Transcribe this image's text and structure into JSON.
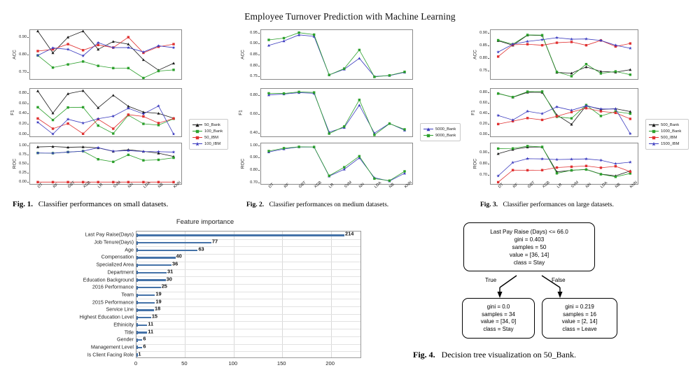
{
  "document": {
    "title": "Employee Turnover Prediction with Machine Learning"
  },
  "figures": {
    "fig1": {
      "caption_label": "Fig. 1.",
      "caption_text": "Classifier performances on small datasets.",
      "legend": [
        "50_Bank",
        "100_Bank",
        "50_IBM",
        "100_IBM"
      ]
    },
    "fig2": {
      "caption_label": "Fig. 2.",
      "caption_text": "Classifier performances on medium datasets.",
      "legend": [
        "5000_Bank",
        "9000_Bank"
      ]
    },
    "fig3": {
      "caption_label": "Fig. 3.",
      "caption_text": "Classifier performances on large datasets.",
      "legend": [
        "500_Bank",
        "1000_Bank",
        "500_IBM",
        "1500_IBM"
      ]
    },
    "fig4": {
      "caption_label": "Fig. 4.",
      "caption_text": "Decision tree visualization on 50_Bank."
    }
  },
  "chart_data": [
    {
      "id": "fig1",
      "type": "line",
      "title": "Classifier performances on small datasets",
      "xlabel": "",
      "categories": [
        "DT",
        "RF",
        "GBT",
        "XGB",
        "LR",
        "SVM",
        "NN",
        "LDA",
        "NB",
        "KNN"
      ],
      "legend_position": "right",
      "grid": false,
      "panels": [
        {
          "ylabel": "ACC",
          "ylim": [
            0.655,
            0.945
          ],
          "yticks": [
            0.7,
            0.8,
            0.9
          ],
          "ytick_labels": [
            "0.70",
            "0.80",
            "0.90"
          ],
          "series": [
            {
              "name": "50_Bank",
              "color": "#1a1a1a",
              "marker": "triangle",
              "values": [
                0.935,
                0.81,
                0.9,
                0.935,
                0.83,
                0.875,
                0.86,
                0.77,
                0.71,
                0.75
              ]
            },
            {
              "name": "100_Bank",
              "color": "#2ca02c",
              "marker": "square",
              "values": [
                0.795,
                0.725,
                0.743,
                0.76,
                0.735,
                0.722,
                0.722,
                0.665,
                0.705,
                0.712
              ]
            },
            {
              "name": "50_IBM",
              "color": "#e03131",
              "marker": "square",
              "values": [
                0.82,
                0.83,
                0.86,
                0.825,
                0.855,
                0.84,
                0.9,
                0.81,
                0.845,
                0.86
              ]
            },
            {
              "name": "100_IBM",
              "color": "#3b3bbf",
              "marker": "star",
              "values": [
                0.795,
                0.838,
                0.83,
                0.793,
                0.868,
                0.84,
                0.84,
                0.815,
                0.85,
                0.84
              ]
            }
          ]
        },
        {
          "ylabel": "F1",
          "ylim": [
            -0.06,
            0.9
          ],
          "yticks": [
            0.0,
            0.2,
            0.4,
            0.6,
            0.8
          ],
          "ytick_labels": [
            "0.00",
            "0.20",
            "0.40",
            "0.60",
            "0.80"
          ],
          "series": [
            {
              "name": "50_Bank",
              "color": "#1a1a1a",
              "marker": "triangle",
              "values": [
                0.845,
                0.41,
                0.79,
                0.85,
                0.515,
                0.76,
                0.545,
                0.43,
                0.405,
                0.31
              ]
            },
            {
              "name": "100_Bank",
              "color": "#2ca02c",
              "marker": "square",
              "values": [
                0.525,
                0.275,
                0.52,
                0.525,
                0.165,
                0.01,
                0.37,
                0.2,
                0.175,
                0.3
              ]
            },
            {
              "name": "50_IBM",
              "color": "#e03131",
              "marker": "square",
              "values": [
                0.305,
                0.105,
                0.205,
                0.005,
                0.29,
                0.105,
                0.38,
                0.345,
                0.215,
                0.305
              ]
            },
            {
              "name": "100_IBM",
              "color": "#3b3bbf",
              "marker": "star",
              "values": [
                0.23,
                0.0,
                0.29,
                0.215,
                0.3,
                0.35,
                0.505,
                0.395,
                0.55,
                0.0
              ]
            }
          ]
        },
        {
          "ylabel": "ROC",
          "ylim": [
            -0.07,
            1.07
          ],
          "yticks": [
            0.0,
            0.25,
            0.5,
            0.75,
            1.0
          ],
          "ytick_labels": [
            "0.00",
            "0.25",
            "0.50",
            "0.75",
            "1.00"
          ],
          "series": [
            {
              "name": "50_Bank",
              "color": "#1a1a1a",
              "marker": "triangle",
              "values": [
                0.955,
                0.965,
                0.945,
                0.955,
                0.93,
                0.835,
                0.88,
                0.835,
                0.785,
                0.695
              ]
            },
            {
              "name": "100_Bank",
              "color": "#2ca02c",
              "marker": "square",
              "values": [
                0.79,
                0.785,
                0.815,
                0.84,
                0.62,
                0.55,
                0.74,
                0.59,
                0.605,
                0.66
              ]
            },
            {
              "name": "50_IBM",
              "color": "#e03131",
              "marker": "square",
              "values": [
                0.0,
                0.0,
                0.0,
                0.0,
                0.0,
                0.0,
                0.0,
                0.0,
                0.0,
                0.0
              ]
            },
            {
              "name": "100_IBM",
              "color": "#3b3bbf",
              "marker": "star",
              "values": [
                0.79,
                0.785,
                0.815,
                0.84,
                0.935,
                0.84,
                0.855,
                0.83,
                0.825,
                0.815
              ]
            }
          ]
        }
      ]
    },
    {
      "id": "fig2",
      "type": "line",
      "title": "Classifier performances on medium datasets",
      "xlabel": "",
      "categories": [
        "DT",
        "RF",
        "GBT",
        "XGB",
        "LR",
        "SVM",
        "NN",
        "LDA",
        "NB",
        "KNN"
      ],
      "legend_position": "right",
      "grid": false,
      "panels": [
        {
          "ylabel": "ACC",
          "ylim": [
            0.735,
            0.965
          ],
          "yticks": [
            0.75,
            0.8,
            0.85,
            0.9,
            0.95
          ],
          "ytick_labels": [
            "0.75",
            "0.80",
            "0.85",
            "0.90",
            "0.95"
          ],
          "series": [
            {
              "name": "5000_Bank",
              "color": "#3b3bbf",
              "marker": "triangle",
              "values": [
                0.892,
                0.912,
                0.94,
                0.933,
                0.757,
                0.783,
                0.833,
                0.75,
                0.754,
                0.769
              ]
            },
            {
              "name": "9000_Bank",
              "color": "#2ca02c",
              "marker": "square",
              "values": [
                0.917,
                0.925,
                0.95,
                0.941,
                0.757,
                0.786,
                0.871,
                0.748,
                0.755,
                0.771
              ]
            }
          ]
        },
        {
          "ylabel": "F1",
          "ylim": [
            0.355,
            0.875
          ],
          "yticks": [
            0.4,
            0.6,
            0.8
          ],
          "ytick_labels": [
            "0.40",
            "0.60",
            "0.80"
          ],
          "series": [
            {
              "name": "5000_Bank",
              "color": "#3b3bbf",
              "marker": "triangle",
              "values": [
                0.803,
                0.812,
                0.827,
                0.82,
                0.408,
                0.457,
                0.694,
                0.397,
                0.5,
                0.428
              ]
            },
            {
              "name": "9000_Bank",
              "color": "#2ca02c",
              "marker": "square",
              "values": [
                0.82,
                0.818,
                0.835,
                0.829,
                0.392,
                0.468,
                0.75,
                0.378,
                0.498,
                0.437
              ]
            }
          ]
        },
        {
          "ylabel": "ROC",
          "ylim": [
            0.685,
            1.02
          ],
          "yticks": [
            0.7,
            0.8,
            0.9,
            1.0
          ],
          "ytick_labels": [
            "0.70",
            "0.80",
            "0.90",
            "1.00"
          ],
          "series": [
            {
              "name": "5000_Bank",
              "color": "#3b3bbf",
              "marker": "triangle",
              "values": [
                0.946,
                0.97,
                0.986,
                0.985,
                0.753,
                0.808,
                0.899,
                0.74,
                0.714,
                0.776
              ]
            },
            {
              "name": "9000_Bank",
              "color": "#2ca02c",
              "marker": "square",
              "values": [
                0.953,
                0.976,
                0.987,
                0.986,
                0.756,
                0.824,
                0.912,
                0.733,
                0.717,
                0.791
              ]
            }
          ]
        }
      ]
    },
    {
      "id": "fig3",
      "type": "line",
      "title": "Classifier performances on large datasets",
      "xlabel": "",
      "categories": [
        "DT",
        "RF",
        "GBT",
        "XGB",
        "LR",
        "SVM",
        "NN",
        "LDA",
        "NB",
        "KNN"
      ],
      "legend_position": "right",
      "grid": false,
      "panels": [
        {
          "ylabel": "ACC",
          "ylim": [
            0.715,
            0.915
          ],
          "yticks": [
            0.75,
            0.8,
            0.85,
            0.9
          ],
          "ytick_labels": [
            "0.75",
            "0.80",
            "0.85",
            "0.90"
          ],
          "series": [
            {
              "name": "500_Bank",
              "color": "#1a1a1a",
              "marker": "triangle",
              "values": [
                0.87,
                0.852,
                0.892,
                0.891,
                0.744,
                0.741,
                0.766,
                0.748,
                0.745,
                0.755
              ]
            },
            {
              "name": "1000_Bank",
              "color": "#2ca02c",
              "marker": "square",
              "values": [
                0.872,
                0.856,
                0.893,
                0.892,
                0.746,
                0.729,
                0.777,
                0.74,
                0.748,
                0.735
              ]
            },
            {
              "name": "500_IBM",
              "color": "#e03131",
              "marker": "square",
              "values": [
                0.807,
                0.854,
                0.856,
                0.852,
                0.862,
                0.865,
                0.852,
                0.871,
                0.847,
                0.859
              ]
            },
            {
              "name": "1500_IBM",
              "color": "#3b3bbf",
              "marker": "star",
              "values": [
                0.825,
                0.856,
                0.867,
                0.874,
                0.882,
                0.876,
                0.877,
                0.871,
                0.852,
                0.84
              ]
            }
          ]
        },
        {
          "ylabel": "F1",
          "ylim": [
            -0.06,
            0.88
          ],
          "yticks": [
            0.0,
            0.2,
            0.4,
            0.6,
            0.8
          ],
          "ytick_labels": [
            "0.00",
            "0.20",
            "0.40",
            "0.60",
            "0.80"
          ],
          "series": [
            {
              "name": "500_Bank",
              "color": "#1a1a1a",
              "marker": "triangle",
              "values": [
                0.78,
                0.705,
                0.8,
                0.798,
                0.365,
                0.185,
                0.545,
                0.47,
                0.485,
                0.43
              ]
            },
            {
              "name": "1000_Bank",
              "color": "#2ca02c",
              "marker": "square",
              "values": [
                0.775,
                0.708,
                0.812,
                0.815,
                0.33,
                0.3,
                0.555,
                0.345,
                0.43,
                0.39
              ]
            },
            {
              "name": "500_IBM",
              "color": "#e03131",
              "marker": "square",
              "values": [
                0.19,
                0.245,
                0.305,
                0.27,
                0.34,
                0.42,
                0.495,
                0.435,
                0.405,
                0.29
              ]
            },
            {
              "name": "1500_IBM",
              "color": "#3b3bbf",
              "marker": "star",
              "values": [
                0.355,
                0.268,
                0.435,
                0.39,
                0.52,
                0.455,
                0.54,
                0.48,
                0.48,
                0.005
              ]
            }
          ]
        },
        {
          "ylabel": "ROC",
          "ylim": [
            0.615,
            0.985
          ],
          "yticks": [
            0.7,
            0.8,
            0.9
          ],
          "ytick_labels": [
            "0.70",
            "0.80",
            "0.90"
          ],
          "series": [
            {
              "name": "500_Bank",
              "color": "#1a1a1a",
              "marker": "triangle",
              "values": [
                0.888,
                0.925,
                0.946,
                0.947,
                0.728,
                0.741,
                0.75,
                0.708,
                0.693,
                0.736
              ]
            },
            {
              "name": "1000_Bank",
              "color": "#2ca02c",
              "marker": "square",
              "values": [
                0.933,
                0.934,
                0.955,
                0.948,
                0.715,
                0.742,
                0.748,
                0.707,
                0.684,
                0.714
              ]
            },
            {
              "name": "500_IBM",
              "color": "#e03131",
              "marker": "square",
              "values": [
                0.637,
                0.743,
                0.742,
                0.743,
                0.766,
                0.773,
                0.78,
                0.764,
                0.777,
                0.73
              ]
            },
            {
              "name": "1500_IBM",
              "color": "#3b3bbf",
              "marker": "star",
              "values": [
                0.692,
                0.81,
                0.844,
                0.842,
                0.836,
                0.839,
                0.842,
                0.83,
                0.8,
                0.813
              ]
            }
          ]
        }
      ]
    },
    {
      "id": "feature_importance",
      "type": "bar",
      "orientation": "horizontal",
      "title": "Feature importance",
      "xlabel": "",
      "ylabel": "",
      "xlim": [
        0,
        232
      ],
      "xticks": [
        0,
        50,
        100,
        150,
        200
      ],
      "xtick_labels": [
        "0",
        "50",
        "100",
        "150",
        "200"
      ],
      "grid": true,
      "bar_color": "#4472a8",
      "categories": [
        "Last Pay Raise(Days)",
        "Job Tenure(Days)",
        "Age",
        "Compensation",
        "Specialized Area",
        "Department",
        "Education Background",
        "2016 Performance",
        "Team",
        "2015 Performance",
        "Service Line",
        "Highest Education Level",
        "Ethinicity",
        "Title",
        "Gender",
        "Management Level",
        "Is Client Facing Role"
      ],
      "values": [
        214,
        77,
        63,
        40,
        36,
        31,
        30,
        25,
        19,
        19,
        18,
        15,
        11,
        11,
        6,
        6,
        1
      ]
    }
  ],
  "decision_tree": {
    "root": {
      "lines": [
        "Last Pay Raise (Days) <= 66.0",
        "gini = 0.403",
        "samples = 50",
        "value = [36, 14]",
        "class = Stay"
      ]
    },
    "edge_true_label": "True",
    "edge_false_label": "False",
    "left_leaf": {
      "lines": [
        "gini = 0.0",
        "samples = 34",
        "value = [34, 0]",
        "class = Stay"
      ]
    },
    "right_leaf": {
      "lines": [
        "gini = 0.219",
        "samples = 16",
        "value = [2, 14]",
        "class = Leave"
      ]
    }
  }
}
